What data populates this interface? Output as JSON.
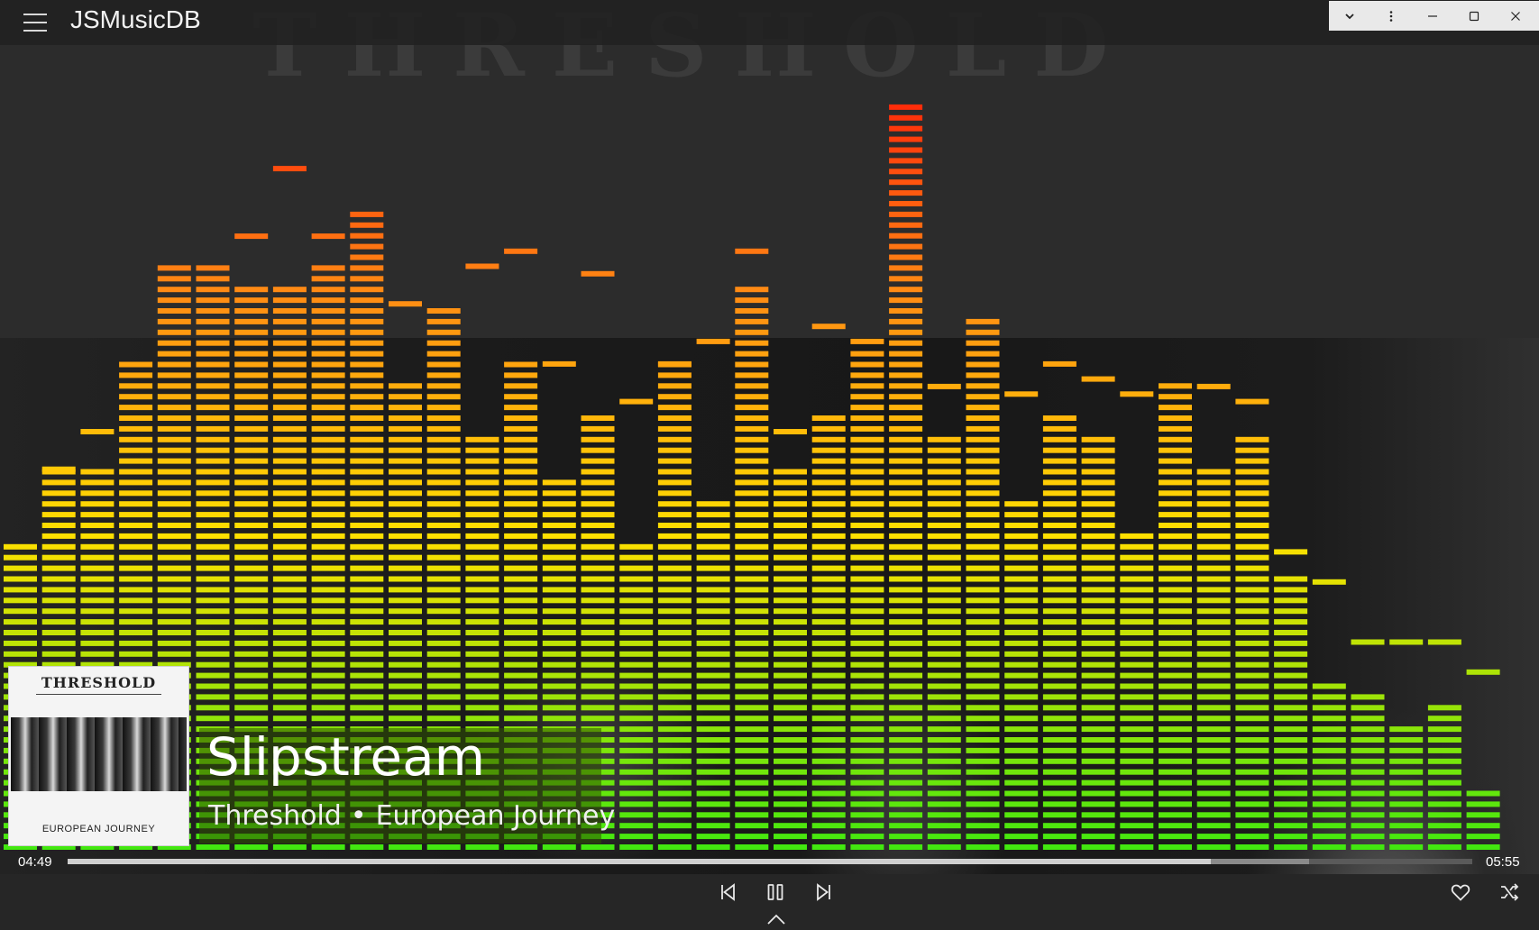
{
  "window": {
    "app_title": "JSMusicDB",
    "controls": [
      "chevron-down-icon",
      "more-vertical-icon",
      "minimize-icon",
      "maximize-icon",
      "close-icon"
    ]
  },
  "background": {
    "watermark_text": "THRESHOLD"
  },
  "equalizer": {
    "bands": 39,
    "levels": [
      0.41,
      0.51,
      0.51,
      0.65,
      0.79,
      0.79,
      0.76,
      0.75,
      0.79,
      0.85,
      0.63,
      0.73,
      0.55,
      0.65,
      0.5,
      0.59,
      0.42,
      0.65,
      0.47,
      0.75,
      0.51,
      0.59,
      0.67,
      1.0,
      0.55,
      0.72,
      0.47,
      0.59,
      0.55,
      0.43,
      0.63,
      0.51,
      0.55,
      0.37,
      0.23,
      0.21,
      0.17,
      0.2,
      0.09
    ],
    "peaks": [
      null,
      0.51,
      0.56,
      null,
      null,
      null,
      0.82,
      0.91,
      0.82,
      null,
      0.73,
      null,
      0.78,
      0.8,
      0.65,
      0.77,
      0.6,
      0.65,
      0.68,
      0.8,
      0.56,
      0.7,
      0.68,
      null,
      0.62,
      null,
      0.61,
      0.65,
      0.63,
      0.61,
      null,
      0.62,
      0.6,
      0.4,
      0.36,
      0.28,
      0.28,
      0.28,
      0.24
    ],
    "colors": {
      "top": "#ff2a0a",
      "upper": "#ff8a14",
      "middle": "#ffe000",
      "bottom": "#3fe80f"
    }
  },
  "now_playing": {
    "title": "Slipstream",
    "artist": "Threshold",
    "separator": "•",
    "album": "European Journey",
    "cover": {
      "band_logo": "THRESHOLD",
      "album_text": "EUROPEAN JOURNEY"
    }
  },
  "playback": {
    "current_time": "04:49",
    "total_time": "05:55",
    "progress": 0.814,
    "buffered": 0.884
  },
  "controls": {
    "prev_icon": "skip-previous-icon",
    "pause_icon": "pause-icon",
    "next_icon": "skip-next-icon",
    "like_icon": "heart-icon",
    "shuffle_icon": "shuffle-icon",
    "expand_icon": "chevron-up-icon"
  }
}
